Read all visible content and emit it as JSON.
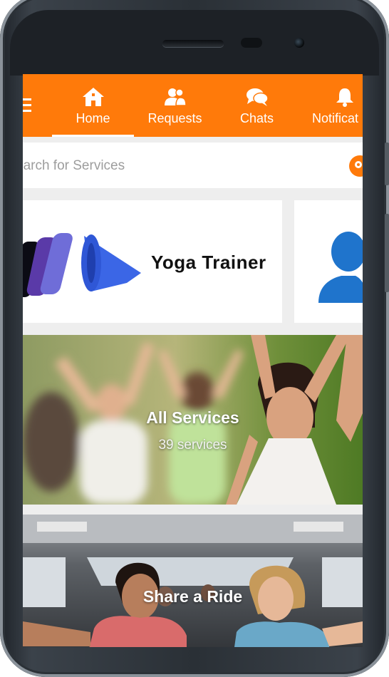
{
  "header": {
    "tabs": [
      {
        "label": "Home",
        "icon": "home-icon",
        "active": true
      },
      {
        "label": "Requests",
        "icon": "users-icon",
        "active": false
      },
      {
        "label": "Chats",
        "icon": "chat-bubbles-icon",
        "active": false
      },
      {
        "label": "Notificat",
        "icon": "bell-icon",
        "active": false
      }
    ],
    "menu_icon": "hamburger-menu-icon",
    "accent_color": "#ff7a0a"
  },
  "search": {
    "placeholder": "earch for Services",
    "button_icon": "search-icon"
  },
  "service_cards": [
    {
      "label": "Yoga Trainer",
      "image": "yoga-mats-image"
    },
    {
      "label": "",
      "image": "person-silhouette-icon"
    }
  ],
  "banners": [
    {
      "title": "All Services",
      "subtitle": "39 services",
      "image": "group-stretching-photo"
    },
    {
      "title": "Share a Ride",
      "subtitle": "",
      "image": "friends-in-car-photo"
    }
  ]
}
